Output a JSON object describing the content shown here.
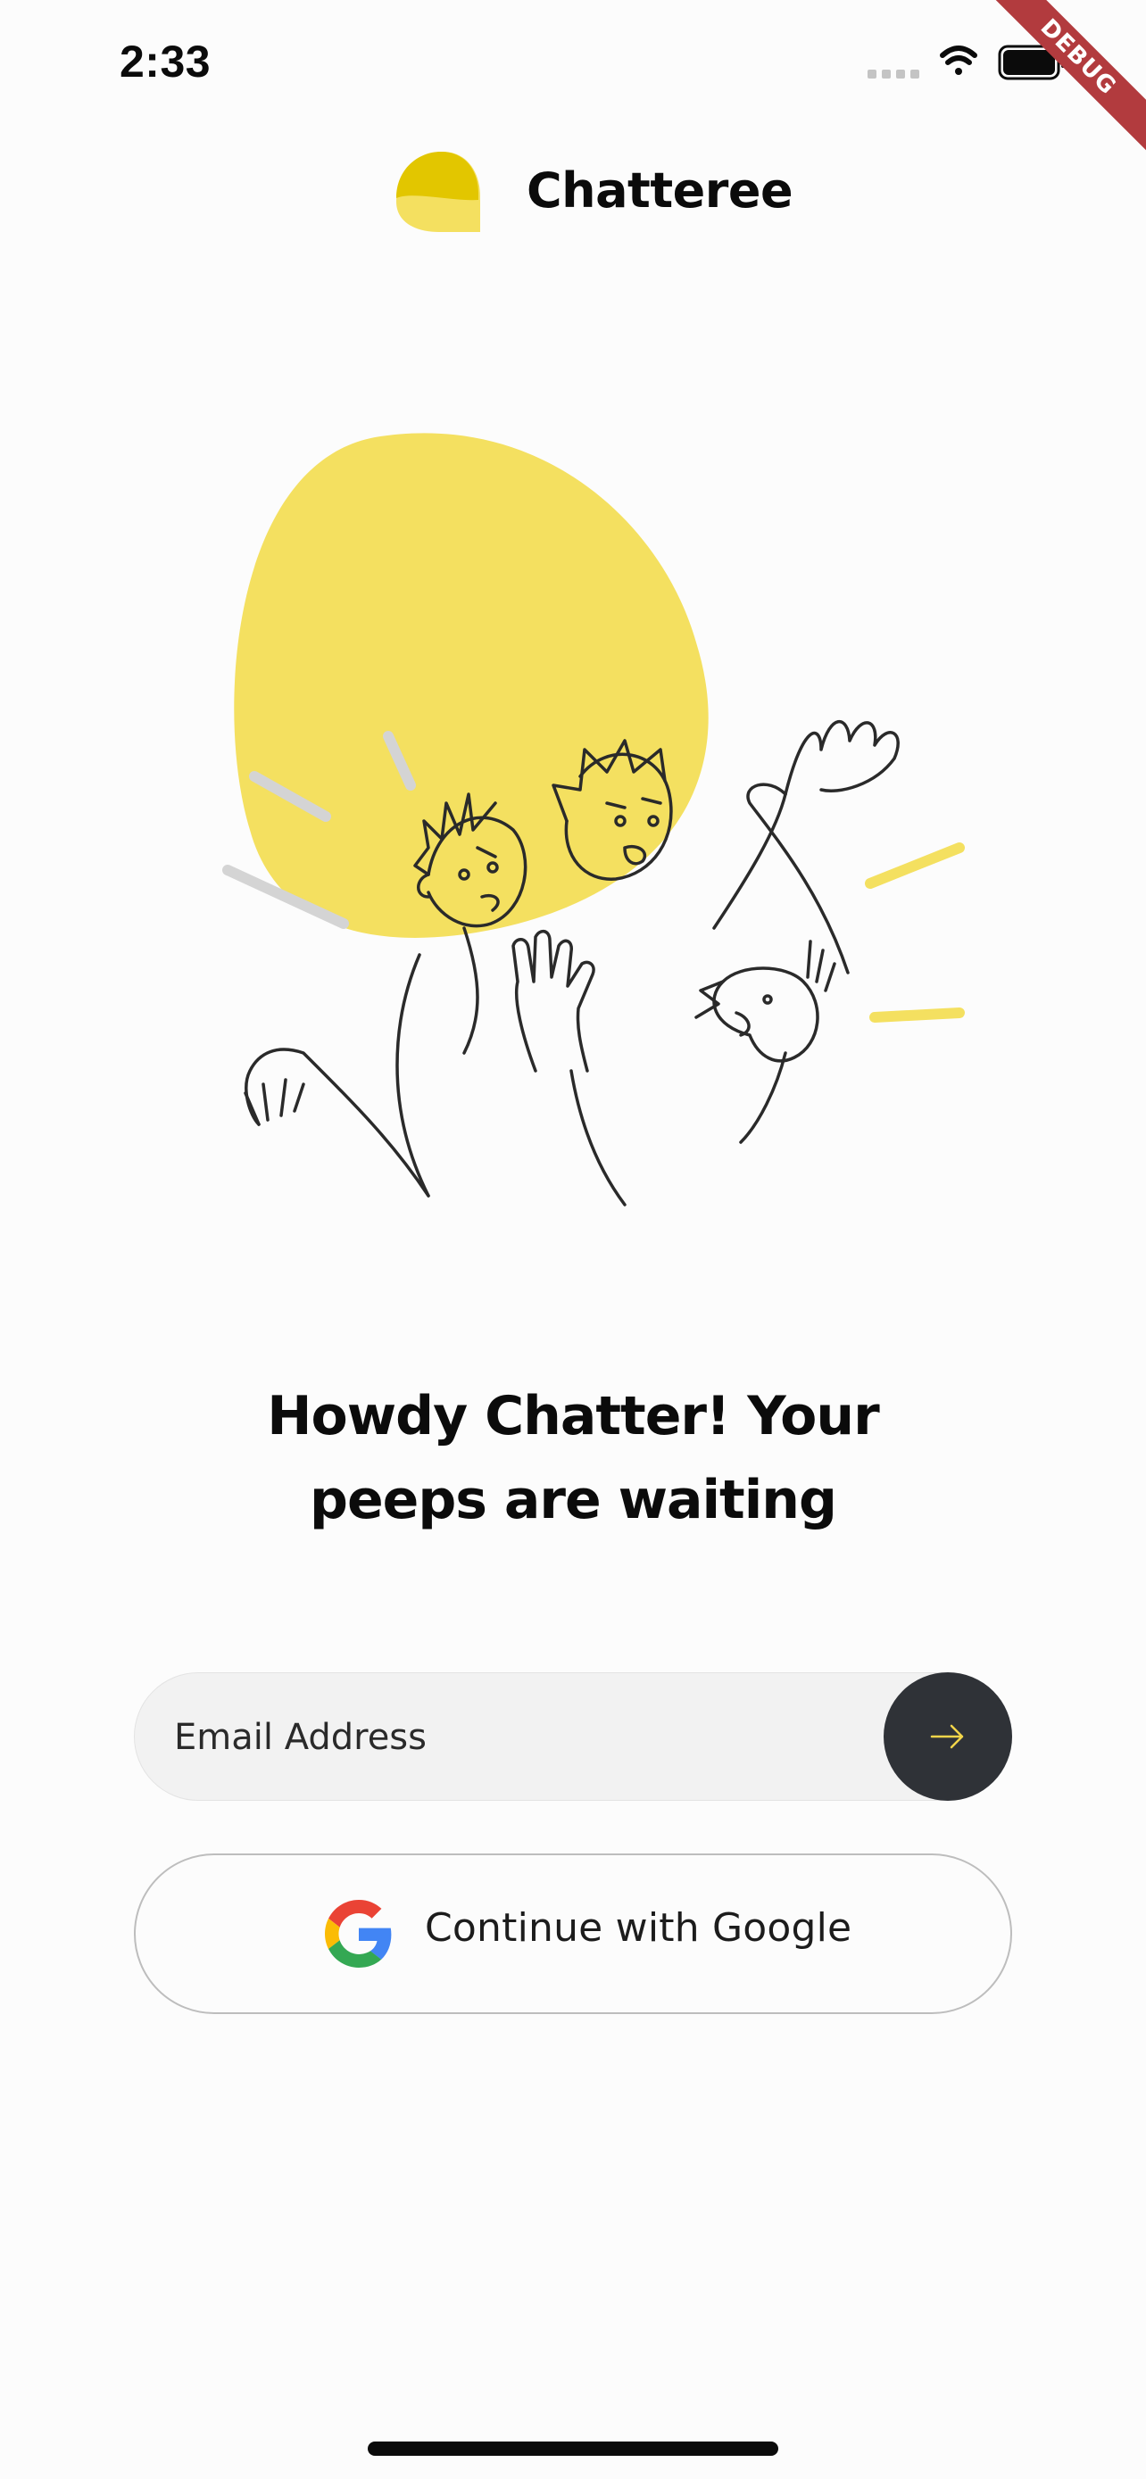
{
  "status_bar": {
    "time": "2:33",
    "icons": [
      "signal-dots-icon",
      "wifi-icon",
      "battery-icon"
    ]
  },
  "debug_banner": {
    "label": "DEBUG",
    "color": "#b23b3e"
  },
  "header": {
    "app_name": "Chatteree",
    "logo_icon": "speech-bubble-logo",
    "brand_color": "#e2c600"
  },
  "hero": {
    "illustration": "waving-people-illustration",
    "accent_color": "#f4e060"
  },
  "headline": {
    "line1": "Howdy Chatter! Your",
    "line2": "peeps are waiting"
  },
  "email": {
    "placeholder": "Email Address",
    "value": "",
    "submit_icon": "arrow-right-icon",
    "submit_color": "#2f3237",
    "arrow_color": "#f2d54a"
  },
  "google": {
    "label": "Continue with Google",
    "icon": "google-g-icon"
  }
}
